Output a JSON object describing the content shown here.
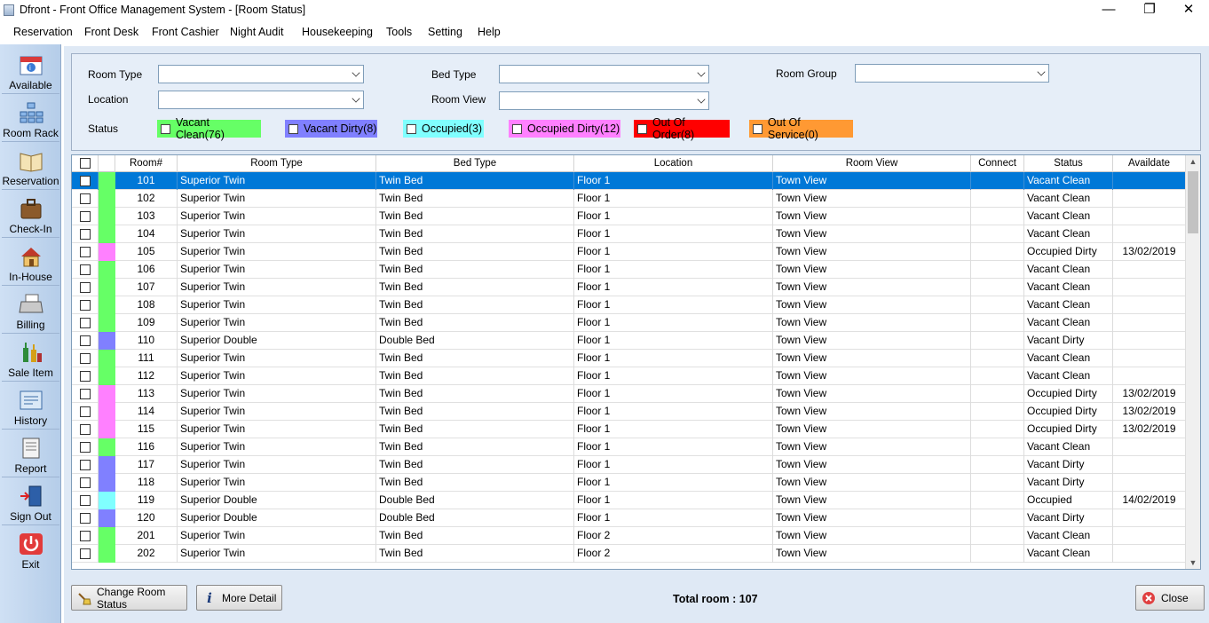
{
  "window": {
    "title": "Dfront - Front Office Management System - [Room Status]",
    "minimize": "—",
    "restore": "❐",
    "close": "✕"
  },
  "menu": [
    "Reservation",
    "Front Desk",
    "Front Cashier",
    "Night Audit",
    "Housekeeping",
    "Tools",
    "Setting",
    "Help"
  ],
  "sidebar": [
    {
      "label": "Available",
      "icon": "available-calendar-icon"
    },
    {
      "label": "Room Rack",
      "icon": "room-rack-icon"
    },
    {
      "label": "Reservation",
      "icon": "reservation-book-icon"
    },
    {
      "label": "Check-In",
      "icon": "check-in-suitcase-icon"
    },
    {
      "label": "In-House",
      "icon": "in-house-icon"
    },
    {
      "label": "Billing",
      "icon": "billing-printer-icon"
    },
    {
      "label": "Sale Item",
      "icon": "sale-item-bottles-icon"
    },
    {
      "label": "History",
      "icon": "history-icon"
    },
    {
      "label": "Report",
      "icon": "report-icon"
    },
    {
      "label": "Sign Out",
      "icon": "sign-out-door-icon"
    },
    {
      "label": "Exit",
      "icon": "exit-power-icon"
    }
  ],
  "filters": {
    "room_type": {
      "label": "Room Type",
      "value": ""
    },
    "bed_type": {
      "label": "Bed Type",
      "value": ""
    },
    "room_group": {
      "label": "Room Group",
      "value": ""
    },
    "location": {
      "label": "Location",
      "value": ""
    },
    "room_view": {
      "label": "Room View",
      "value": ""
    },
    "status_label": "Status"
  },
  "legend": [
    {
      "label": "Vacant Clean(76)",
      "color": "#66ff66"
    },
    {
      "label": "Vacant Dirty(8)",
      "color": "#8080ff"
    },
    {
      "label": "Occupied(3)",
      "color": "#80ffff"
    },
    {
      "label": "Occupied Dirty(12)",
      "color": "#ff80ff"
    },
    {
      "label": "Out Of Order(8)",
      "color": "#ff0000"
    },
    {
      "label": "Out Of Service(0)",
      "color": "#ff9933"
    }
  ],
  "columns": [
    "",
    "",
    "Room#",
    "Room Type",
    "Bed Type",
    "Location",
    "Room View",
    "Connect",
    "Status",
    "Availdate"
  ],
  "rows": [
    {
      "room": "101",
      "type": "Superior Twin",
      "bed": "Twin Bed",
      "loc": "Floor 1",
      "view": "Town View",
      "connect": "",
      "status": "Vacant Clean",
      "date": "",
      "color": "#66ff66",
      "selected": true
    },
    {
      "room": "102",
      "type": "Superior Twin",
      "bed": "Twin Bed",
      "loc": "Floor 1",
      "view": "Town View",
      "connect": "",
      "status": "Vacant Clean",
      "date": "",
      "color": "#66ff66"
    },
    {
      "room": "103",
      "type": "Superior Twin",
      "bed": "Twin Bed",
      "loc": "Floor 1",
      "view": "Town View",
      "connect": "",
      "status": "Vacant Clean",
      "date": "",
      "color": "#66ff66"
    },
    {
      "room": "104",
      "type": "Superior Twin",
      "bed": "Twin Bed",
      "loc": "Floor 1",
      "view": "Town View",
      "connect": "",
      "status": "Vacant Clean",
      "date": "",
      "color": "#66ff66"
    },
    {
      "room": "105",
      "type": "Superior Twin",
      "bed": "Twin Bed",
      "loc": "Floor 1",
      "view": "Town View",
      "connect": "",
      "status": "Occupied Dirty",
      "date": "13/02/2019",
      "color": "#ff80ff"
    },
    {
      "room": "106",
      "type": "Superior Twin",
      "bed": "Twin Bed",
      "loc": "Floor 1",
      "view": "Town View",
      "connect": "",
      "status": "Vacant Clean",
      "date": "",
      "color": "#66ff66"
    },
    {
      "room": "107",
      "type": "Superior Twin",
      "bed": "Twin Bed",
      "loc": "Floor 1",
      "view": "Town View",
      "connect": "",
      "status": "Vacant Clean",
      "date": "",
      "color": "#66ff66"
    },
    {
      "room": "108",
      "type": "Superior Twin",
      "bed": "Twin Bed",
      "loc": "Floor 1",
      "view": "Town View",
      "connect": "",
      "status": "Vacant Clean",
      "date": "",
      "color": "#66ff66"
    },
    {
      "room": "109",
      "type": "Superior Twin",
      "bed": "Twin Bed",
      "loc": "Floor 1",
      "view": "Town View",
      "connect": "",
      "status": "Vacant Clean",
      "date": "",
      "color": "#66ff66"
    },
    {
      "room": "110",
      "type": "Superior Double",
      "bed": "Double Bed",
      "loc": "Floor 1",
      "view": "Town View",
      "connect": "",
      "status": "Vacant Dirty",
      "date": "",
      "color": "#8080ff"
    },
    {
      "room": "111",
      "type": "Superior Twin",
      "bed": "Twin Bed",
      "loc": "Floor 1",
      "view": "Town View",
      "connect": "",
      "status": "Vacant Clean",
      "date": "",
      "color": "#66ff66"
    },
    {
      "room": "112",
      "type": "Superior Twin",
      "bed": "Twin Bed",
      "loc": "Floor 1",
      "view": "Town View",
      "connect": "",
      "status": "Vacant Clean",
      "date": "",
      "color": "#66ff66"
    },
    {
      "room": "113",
      "type": "Superior Twin",
      "bed": "Twin Bed",
      "loc": "Floor 1",
      "view": "Town View",
      "connect": "",
      "status": "Occupied Dirty",
      "date": "13/02/2019",
      "color": "#ff80ff"
    },
    {
      "room": "114",
      "type": "Superior Twin",
      "bed": "Twin Bed",
      "loc": "Floor 1",
      "view": "Town View",
      "connect": "",
      "status": "Occupied Dirty",
      "date": "13/02/2019",
      "color": "#ff80ff"
    },
    {
      "room": "115",
      "type": "Superior Twin",
      "bed": "Twin Bed",
      "loc": "Floor 1",
      "view": "Town View",
      "connect": "",
      "status": "Occupied Dirty",
      "date": "13/02/2019",
      "color": "#ff80ff"
    },
    {
      "room": "116",
      "type": "Superior Twin",
      "bed": "Twin Bed",
      "loc": "Floor 1",
      "view": "Town View",
      "connect": "",
      "status": "Vacant Clean",
      "date": "",
      "color": "#66ff66"
    },
    {
      "room": "117",
      "type": "Superior Twin",
      "bed": "Twin Bed",
      "loc": "Floor 1",
      "view": "Town View",
      "connect": "",
      "status": "Vacant Dirty",
      "date": "",
      "color": "#8080ff"
    },
    {
      "room": "118",
      "type": "Superior Twin",
      "bed": "Twin Bed",
      "loc": "Floor 1",
      "view": "Town View",
      "connect": "",
      "status": "Vacant Dirty",
      "date": "",
      "color": "#8080ff"
    },
    {
      "room": "119",
      "type": "Superior Double",
      "bed": "Double Bed",
      "loc": "Floor 1",
      "view": "Town View",
      "connect": "",
      "status": "Occupied",
      "date": "14/02/2019",
      "color": "#80ffff"
    },
    {
      "room": "120",
      "type": "Superior Double",
      "bed": "Double Bed",
      "loc": "Floor 1",
      "view": "Town View",
      "connect": "",
      "status": "Vacant Dirty",
      "date": "",
      "color": "#8080ff"
    },
    {
      "room": "201",
      "type": "Superior Twin",
      "bed": "Twin Bed",
      "loc": "Floor 2",
      "view": "Town View",
      "connect": "",
      "status": "Vacant Clean",
      "date": "",
      "color": "#66ff66"
    },
    {
      "room": "202",
      "type": "Superior Twin",
      "bed": "Twin Bed",
      "loc": "Floor 2",
      "view": "Town View",
      "connect": "",
      "status": "Vacant Clean",
      "date": "",
      "color": "#66ff66"
    }
  ],
  "buttons": {
    "change_status": "Change Room Status",
    "more_detail": "More Detail",
    "close": "Close"
  },
  "total_label": "Total room : 107"
}
